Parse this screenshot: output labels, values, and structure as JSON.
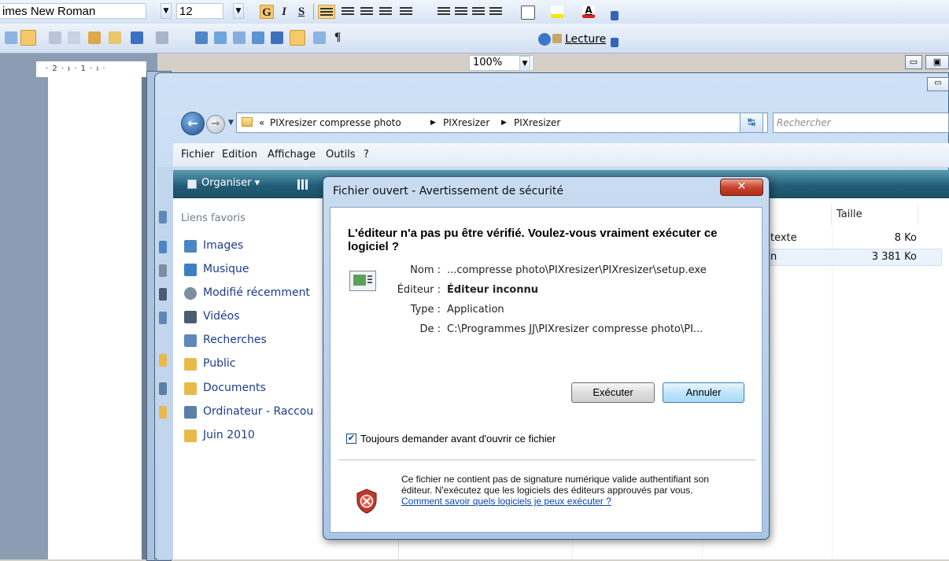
{
  "word": {
    "font_name": "imes New Roman",
    "font_size": "12",
    "zoom": "100%",
    "lecture": "Lecture",
    "ruler": "· 2 · ı · 1 · ı ·"
  },
  "explorer": {
    "crumbs": [
      "PIXresizer compresse photo",
      "PIXresizer",
      "PIXresizer"
    ],
    "crumb_prefix": "«",
    "search_placeholder": "Rechercher",
    "menu": [
      "Fichier",
      "Edition",
      "Affichage",
      "Outils",
      "?"
    ],
    "organiser": "Organiser",
    "nav_title": "Liens favoris",
    "nav_items": [
      {
        "label": "Images",
        "icon": "images-icon",
        "color": "#4a86c5"
      },
      {
        "label": "Musique",
        "icon": "music-icon",
        "color": "#3b7fc4"
      },
      {
        "label": "Modifié récemment",
        "icon": "recent-icon",
        "color": "#7d8ea3"
      },
      {
        "label": "Vidéos",
        "icon": "videos-icon",
        "color": "#4b5d73"
      },
      {
        "label": "Recherches",
        "icon": "search-folder-icon",
        "color": "#5f87b8"
      },
      {
        "label": "Public",
        "icon": "folder-icon",
        "color": "#e8b84b"
      },
      {
        "label": "Documents",
        "icon": "folder-icon",
        "color": "#e8b84b"
      },
      {
        "label": "Ordinateur - Raccou",
        "icon": "computer-icon",
        "color": "#5a7fa8"
      },
      {
        "label": "Juin 2010",
        "icon": "folder-icon",
        "color": "#e8b84b"
      }
    ],
    "columns": {
      "taille": "Taille"
    },
    "rows": [
      {
        "type": "texte",
        "size": "8 Ko"
      },
      {
        "type": "n",
        "size": "3 381 Ko"
      }
    ]
  },
  "dialog": {
    "title": "Fichier ouvert - Avertissement de sécurité",
    "heading": "L'éditeur n'a pas pu être vérifié. Voulez-vous vraiment exécuter ce logiciel ?",
    "props": [
      {
        "label": "Nom :",
        "value": "...compresse photo\\PIXresizer\\PIXresizer\\setup.exe",
        "bold": false
      },
      {
        "label": "Éditeur :",
        "value": "Éditeur inconnu",
        "bold": true
      },
      {
        "label": "Type :",
        "value": "Application",
        "bold": false
      },
      {
        "label": "De :",
        "value": "C:\\Programmes JJ\\PIXresizer compresse photo\\PI...",
        "bold": false
      }
    ],
    "run_button": "Exécuter",
    "cancel_button": "Annuler",
    "checkbox_label": "Toujours demander avant d'ouvrir ce fichier",
    "checkbox_checked": "✔",
    "warning_text": "Ce fichier ne contient pas de signature numérique valide authentifiant son éditeur. N'exécutez que les logiciels des éditeurs approuvés par vous.",
    "warning_link": "Comment savoir quels logiciels je peux exécuter ?"
  }
}
